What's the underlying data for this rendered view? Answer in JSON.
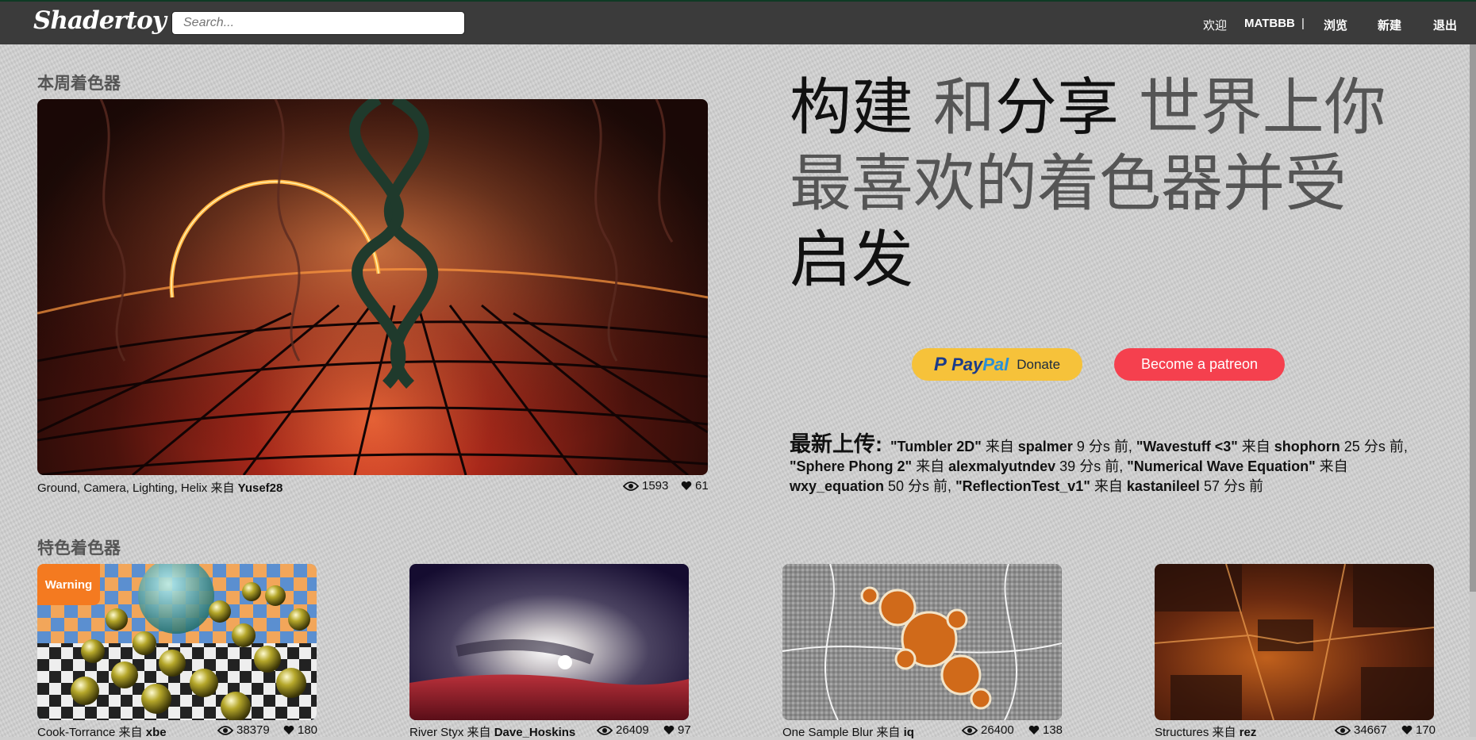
{
  "app": {
    "logo": "Shadertoy"
  },
  "search": {
    "placeholder": "Search..."
  },
  "nav": {
    "welcome": "欢迎",
    "user": "MATBBB",
    "separator": "|",
    "browse": "浏览",
    "new": "新建",
    "logout": "退出"
  },
  "weekly": {
    "title": "本周着色器",
    "shader": {
      "name": "Ground, Camera, Lighting, Helix",
      "from": "来自",
      "author": "Yusef28",
      "views": "1593",
      "likes": "61"
    }
  },
  "headline": {
    "p1": "构建",
    "p2": " 和",
    "p3": "分享",
    "p4": " 世界上你最喜欢的着色器并受",
    "p5": " 启发"
  },
  "donate": {
    "paypal_brand_a": "Pay",
    "paypal_brand_b": "Pal",
    "paypal_label": "Donate",
    "patreon_label": "Become a patreon"
  },
  "latest": {
    "label": "最新上传:",
    "items": [
      {
        "title": "\"Tumbler 2D\"",
        "from": " 来自 ",
        "author": "spalmer",
        "time": " 9 分s 前, "
      },
      {
        "title": "\"Wavestuff <3\"",
        "from": " 来自 ",
        "author": "shophorn",
        "time": " 25 分s 前, "
      },
      {
        "title": "\"Sphere Phong 2\"",
        "from": " 来自 ",
        "author": "alexmalyutndev",
        "time": " 39 分s 前, "
      },
      {
        "title": "\"Numerical Wave Equation\"",
        "from": " 来自 ",
        "author": "wxy_equation",
        "time": " 50 分s 前, "
      },
      {
        "title": "\"ReflectionTest_v1\"",
        "from": " 来自 ",
        "author": "kastanileel",
        "time": " 57 分s 前"
      }
    ]
  },
  "featured": {
    "title": "特色着色器",
    "items": [
      {
        "name": "Cook-Torrance",
        "from": "来自",
        "author": "xbe",
        "views": "38379",
        "likes": "180",
        "badge": "Warning"
      },
      {
        "name": "River Styx",
        "from": "来自",
        "author": "Dave_Hoskins",
        "views": "26409",
        "likes": "97"
      },
      {
        "name": "One Sample Blur",
        "from": "来自",
        "author": "iq",
        "views": "26400",
        "likes": "138"
      },
      {
        "name": "Structures",
        "from": "来自",
        "author": "rez",
        "views": "34667",
        "likes": "170"
      }
    ]
  },
  "colors": {
    "topbar": "#3b3b3b",
    "paypal": "#f6c23a",
    "patreon": "#f5404e",
    "warning": "#f47a20"
  },
  "icons": [
    "eye-icon",
    "heart-icon"
  ]
}
